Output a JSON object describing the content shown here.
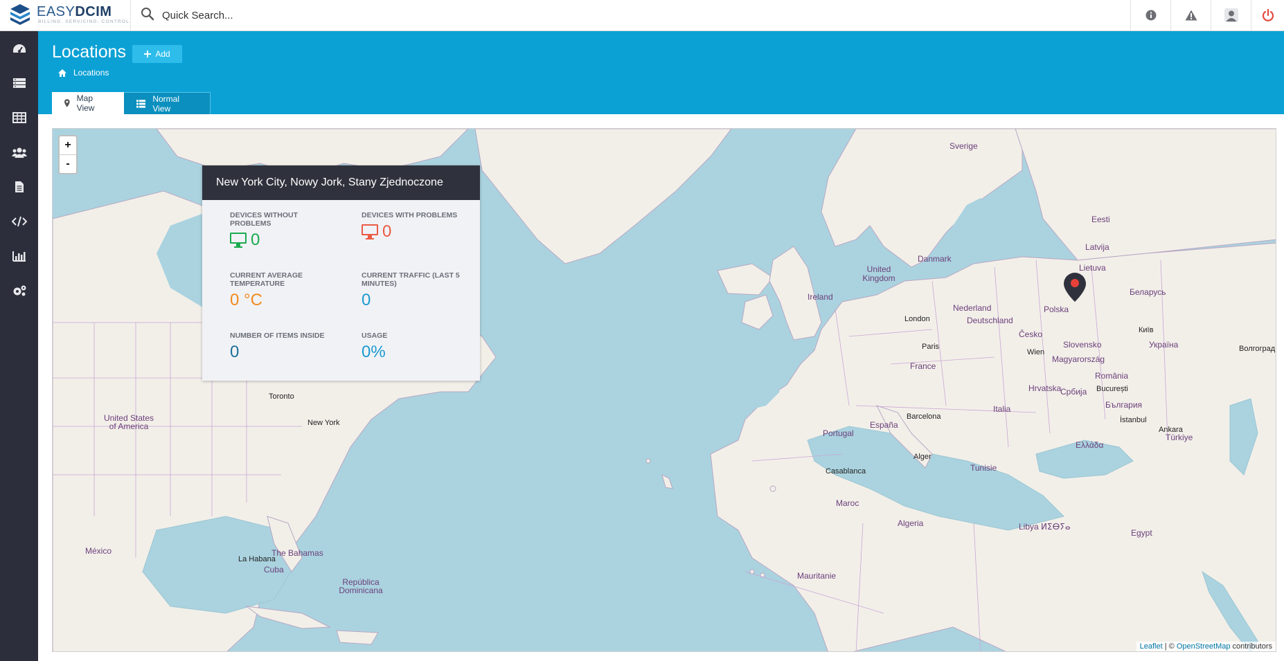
{
  "app": {
    "logo_text_light": "EASY",
    "logo_text_bold": "DCIM",
    "logo_tagline": "BILLING. SERVICING. CONTROL."
  },
  "search": {
    "placeholder": "Quick Search..."
  },
  "topbar_icons": [
    "info-icon",
    "warning-icon",
    "user-icon",
    "power-icon"
  ],
  "sidebar": {
    "items": [
      {
        "icon": "dashboard-icon"
      },
      {
        "icon": "servers-icon"
      },
      {
        "icon": "table-icon"
      },
      {
        "icon": "users-icon"
      },
      {
        "icon": "document-icon"
      },
      {
        "icon": "code-icon"
      },
      {
        "icon": "chart-icon"
      },
      {
        "icon": "settings-icon"
      }
    ]
  },
  "header": {
    "title": "Locations",
    "add_label": "Add",
    "breadcrumb": "Locations"
  },
  "tabs": [
    {
      "label": "Map View",
      "active": true
    },
    {
      "label": "Normal View",
      "active": false
    }
  ],
  "popup": {
    "title": "New York City, Nowy Jork, Stany Zjednoczone",
    "stats": {
      "ok_label": "DEVICES WITHOUT PROBLEMS",
      "ok_value": "0",
      "bad_label": "DEVICES WITH PROBLEMS",
      "bad_value": "0",
      "temp_label": "CURRENT AVERAGE TEMPERATURE",
      "temp_value": "0 °C",
      "traffic_label": "CURRENT TRAFFIC (LAST 5 MINUTES)",
      "traffic_value": "0",
      "items_label": "NUMBER OF ITEMS INSIDE",
      "items_value": "0",
      "usage_label": "USAGE",
      "usage_value": "0%"
    }
  },
  "map": {
    "zoom_in": "+",
    "zoom_out": "-",
    "attribution_leaflet": "Leaflet",
    "attribution_sep": " | © ",
    "attribution_osm": "OpenStreetMap",
    "attribution_tail": " contributors",
    "labels": {
      "sverige": "Sverige",
      "eesti": "Eesti",
      "latvija": "Latvija",
      "lietuva": "Lietuva",
      "danmark": "Danmark",
      "uk": "United Kingdom",
      "ireland": "Ireland",
      "london": "London",
      "nederland": "Nederland",
      "deutschland": "Deutschland",
      "polska": "Polska",
      "belarus": "Беларусь",
      "kyiv": "Київ",
      "ukraina": "Україна",
      "volgograd": "Волгоград",
      "paris": "Paris",
      "france": "France",
      "cesko": "Česko",
      "slovensko": "Slovensko",
      "wien": "Wien",
      "magyarorszag": "Magyarország",
      "romania": "România",
      "bucuresti": "București",
      "hrvatska": "Hrvatska",
      "srbija": "Србија",
      "balgaria": "България",
      "italia": "Italia",
      "barcelona": "Barcelona",
      "espana": "España",
      "portugal": "Portugal",
      "istanbul": "İstanbul",
      "ankara": "Ankara",
      "turkiye": "Türkiye",
      "ellada": "Ελλάδα",
      "alger": "Alger",
      "tunisie": "Tunisie",
      "casablanca": "Casablanca",
      "maroc": "Maroc",
      "algeria": "Algeria",
      "libya": "Libya ⵍⵉⴱⵢⴰ",
      "egypt": "Egypt",
      "mauritanie": "Mauritanie",
      "toronto": "Toronto",
      "newyork": "New York",
      "usa": "United States of America",
      "mexico": "México",
      "lahabana": "La Habana",
      "cuba": "Cuba",
      "bahamas": "The Bahamas",
      "dominicana": "República Dominicana"
    }
  }
}
